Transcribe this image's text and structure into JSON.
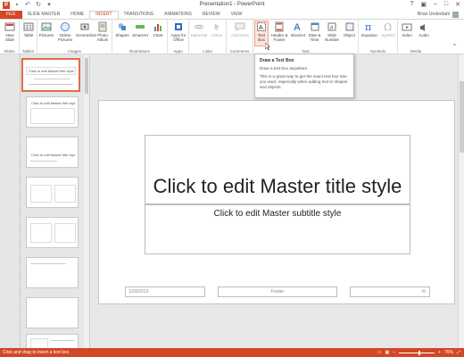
{
  "app": {
    "title": "Presentation1 - PowerPoint"
  },
  "ribbon_tabs": [
    "FILE",
    "SLIDE MASTER",
    "HOME",
    "INSERT",
    "TRANSITIONS",
    "ANIMATIONS",
    "REVIEW",
    "VIEW"
  ],
  "active_tab": "INSERT",
  "user": {
    "name": "Brian Underdahl"
  },
  "ribbon": {
    "slides": {
      "label": "Slides",
      "new_slide": "New Slide"
    },
    "tables": {
      "label": "Tables",
      "table": "Table"
    },
    "images": {
      "label": "Images",
      "pictures": "Pictures",
      "online_pictures": "Online Pictures",
      "screenshot": "Screenshot",
      "photo_album": "Photo Album"
    },
    "illustrations": {
      "label": "Illustrations",
      "shapes": "Shapes",
      "smartart": "SmartArt",
      "chart": "Chart"
    },
    "apps": {
      "label": "Apps",
      "apps_for_office": "Apps for Office"
    },
    "links": {
      "label": "Links",
      "hyperlink": "Hyperlink",
      "action": "Action"
    },
    "comments": {
      "label": "Comments",
      "comment": "Comment"
    },
    "text": {
      "label": "Text",
      "text_box": "Text Box",
      "header_footer": "Header & Footer",
      "wordart": "WordArt",
      "date_time": "Date & Time",
      "slide_number": "Slide Number",
      "object": "Object"
    },
    "symbols": {
      "label": "Symbols",
      "equation": "Equation",
      "symbol": "Symbol"
    },
    "media": {
      "label": "Media",
      "video": "Video",
      "audio": "Audio"
    }
  },
  "tooltip": {
    "heading": "Draw a Text Box",
    "line1": "Draw a text box anywhere.",
    "line2": "This is a great way to get the exact text box size you want, especially when adding text to shapes and objects."
  },
  "thumbnails": {
    "master_title": "Click to edit Master title style",
    "layout_titles": [
      "Click to edit Master title style",
      "",
      "Click to edit Master title style",
      "",
      "",
      "",
      "",
      ""
    ]
  },
  "slide": {
    "title": "Click to edit Master title style",
    "subtitle": "Click to edit Master subtitle style",
    "date": "1/29/2013",
    "footer": "Footer",
    "number": "‹#›"
  },
  "status": {
    "message": "Click and drag to insert a text box.",
    "zoom": "76%"
  },
  "colors": {
    "accent": "#d24726",
    "highlight": "#fce4dc"
  }
}
